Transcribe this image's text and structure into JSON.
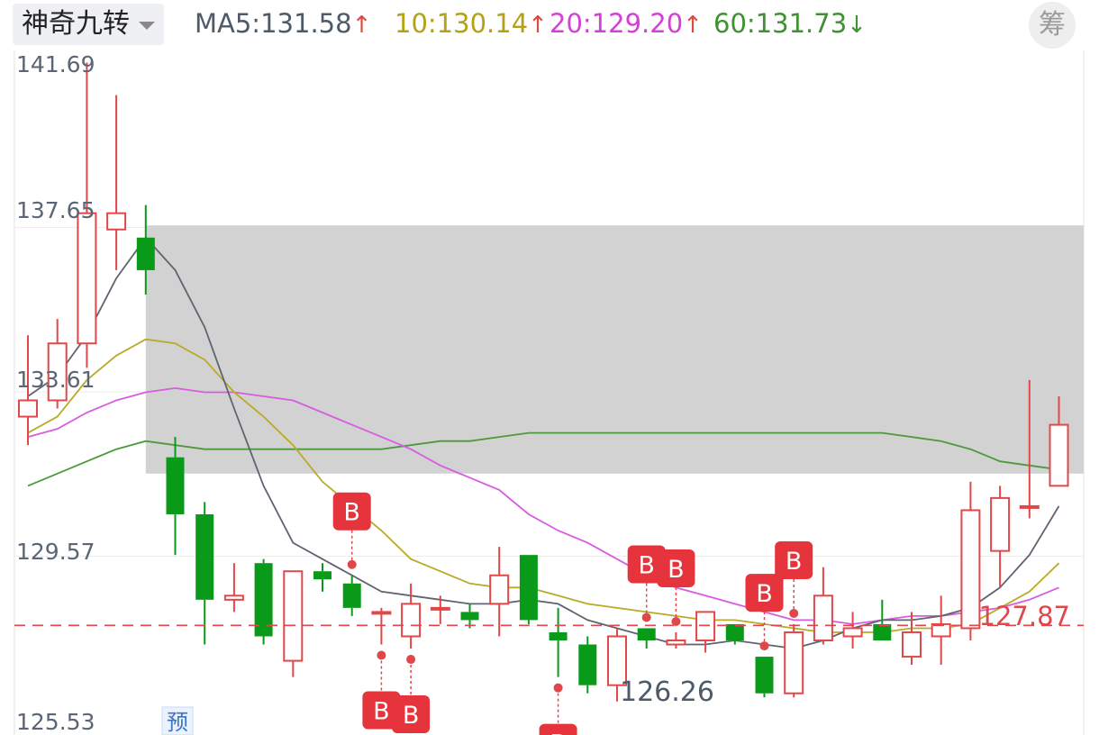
{
  "header": {
    "indicator_name": "神奇九转",
    "ma": [
      {
        "label": "MA5:",
        "value": "131.58",
        "arrow": "↑",
        "color": "#4d5a6a",
        "arrow_color": "#e2473f"
      },
      {
        "label": "10:",
        "value": "130.14",
        "arrow": "↑",
        "color": "#b3a116",
        "arrow_color": "#e2473f"
      },
      {
        "label": "20:",
        "value": "129.20",
        "arrow": "↑",
        "color": "#d43fd6",
        "arrow_color": "#e2473f"
      },
      {
        "label": "60:",
        "value": "131.73",
        "arrow": "↓",
        "color": "#3f9133",
        "arrow_color": "#3f9133"
      }
    ],
    "chip_button": "筹"
  },
  "chart_data": {
    "type": "candlestick",
    "y_ticks": [
      "141.69",
      "137.65",
      "133.61",
      "129.57",
      "125.53"
    ],
    "ylim": [
      125.53,
      141.69
    ],
    "current_price_label": "127.87",
    "low_label": "126.26",
    "forecast_label": "预",
    "signal_label": "B",
    "colors": {
      "up": "#e2474a",
      "down": "#0a9a1a",
      "ma5": "#5e6470",
      "ma10": "#b8ab25",
      "ma20": "#d95be0",
      "ma60": "#4c9a3c"
    },
    "candles": [
      {
        "o": 133.0,
        "c": 133.4,
        "h": 135.0,
        "l": 132.3
      },
      {
        "o": 133.4,
        "c": 134.8,
        "h": 135.4,
        "l": 133.2
      },
      {
        "o": 134.8,
        "c": 138.0,
        "h": 141.7,
        "l": 134.2
      },
      {
        "o": 137.6,
        "c": 138.0,
        "h": 140.9,
        "l": 136.6
      },
      {
        "o": 137.4,
        "c": 136.6,
        "h": 138.2,
        "l": 136.0
      },
      {
        "o": 132.0,
        "c": 130.6,
        "h": 132.5,
        "l": 129.6
      },
      {
        "o": 130.6,
        "c": 128.5,
        "h": 130.9,
        "l": 127.4
      },
      {
        "o": 128.5,
        "c": 128.6,
        "h": 129.4,
        "l": 128.2
      },
      {
        "o": 129.4,
        "c": 127.6,
        "h": 129.5,
        "l": 127.4
      },
      {
        "o": 127.0,
        "c": 129.2,
        "h": 129.2,
        "l": 126.6
      },
      {
        "o": 129.2,
        "c": 129.0,
        "h": 129.4,
        "l": 128.7
      },
      {
        "o": 128.9,
        "c": 128.3,
        "h": 129.1,
        "l": 128.1
      },
      {
        "o": 128.2,
        "c": 128.2,
        "h": 128.3,
        "l": 127.4
      },
      {
        "o": 127.6,
        "c": 128.4,
        "h": 128.9,
        "l": 127.3
      },
      {
        "o": 128.3,
        "c": 128.3,
        "h": 128.6,
        "l": 127.9
      },
      {
        "o": 128.2,
        "c": 128.0,
        "h": 128.4,
        "l": 127.8
      },
      {
        "o": 128.4,
        "c": 129.1,
        "h": 129.8,
        "l": 127.6
      },
      {
        "o": 129.6,
        "c": 128.0,
        "h": 129.6,
        "l": 127.9
      },
      {
        "o": 127.7,
        "c": 127.5,
        "h": 128.3,
        "l": 126.6
      },
      {
        "o": 127.4,
        "c": 126.4,
        "h": 127.6,
        "l": 126.2
      },
      {
        "o": 126.4,
        "c": 127.6,
        "h": 127.8,
        "l": 126.0
      },
      {
        "o": 127.8,
        "c": 127.5,
        "h": 127.8,
        "l": 127.3
      },
      {
        "o": 127.4,
        "c": 127.5,
        "h": 127.7,
        "l": 127.3
      },
      {
        "o": 127.5,
        "c": 128.2,
        "h": 128.2,
        "l": 127.2
      },
      {
        "o": 127.9,
        "c": 127.5,
        "h": 127.9,
        "l": 127.4
      },
      {
        "o": 127.1,
        "c": 126.2,
        "h": 127.1,
        "l": 126.1
      },
      {
        "o": 126.2,
        "c": 127.7,
        "h": 127.9,
        "l": 126.1
      },
      {
        "o": 127.5,
        "c": 128.6,
        "h": 129.3,
        "l": 127.4
      },
      {
        "o": 127.6,
        "c": 127.8,
        "h": 128.2,
        "l": 127.3
      },
      {
        "o": 127.9,
        "c": 127.5,
        "h": 128.5,
        "l": 127.5
      },
      {
        "o": 127.1,
        "c": 127.7,
        "h": 128.2,
        "l": 126.9
      },
      {
        "o": 127.6,
        "c": 127.9,
        "h": 128.6,
        "l": 126.9
      },
      {
        "o": 127.8,
        "c": 130.7,
        "h": 131.4,
        "l": 127.5
      },
      {
        "o": 129.7,
        "c": 131.0,
        "h": 131.3,
        "l": 128.8
      },
      {
        "o": 130.8,
        "c": 130.8,
        "h": 133.9,
        "l": 130.5
      },
      {
        "o": 131.3,
        "c": 132.8,
        "h": 133.5,
        "l": 131.3
      }
    ],
    "ma5": [
      133.5,
      134.0,
      135.0,
      136.4,
      137.4,
      136.6,
      135.2,
      133.2,
      131.3,
      129.9,
      129.5,
      129.1,
      128.7,
      128.6,
      128.5,
      128.4,
      128.4,
      128.5,
      128.4,
      128.0,
      127.8,
      127.6,
      127.4,
      127.4,
      127.5,
      127.4,
      127.3,
      127.5,
      127.8,
      128.0,
      128.0,
      128.1,
      128.3,
      128.8,
      129.6,
      130.8
    ],
    "ma10": [
      132.6,
      133.0,
      133.9,
      134.5,
      134.9,
      134.8,
      134.4,
      133.6,
      133.0,
      132.3,
      131.4,
      130.8,
      130.2,
      129.5,
      129.2,
      128.9,
      128.8,
      128.8,
      128.6,
      128.4,
      128.3,
      128.2,
      128.1,
      128.0,
      128.0,
      127.9,
      127.8,
      127.7,
      127.7,
      127.7,
      127.8,
      127.8,
      127.9,
      128.3,
      128.7,
      129.4
    ],
    "ma20": [
      132.5,
      132.7,
      133.1,
      133.4,
      133.6,
      133.7,
      133.6,
      133.6,
      133.5,
      133.4,
      133.1,
      132.8,
      132.5,
      132.2,
      131.8,
      131.5,
      131.2,
      130.6,
      130.2,
      129.9,
      129.5,
      129.1,
      128.8,
      128.6,
      128.4,
      128.2,
      128.0,
      128.0,
      127.9,
      128.0,
      128.1,
      128.1,
      128.2,
      128.3,
      128.5,
      128.8
    ],
    "ma60": [
      131.3,
      131.6,
      131.9,
      132.2,
      132.4,
      132.3,
      132.2,
      132.2,
      132.2,
      132.2,
      132.2,
      132.2,
      132.2,
      132.3,
      132.4,
      132.4,
      132.5,
      132.6,
      132.6,
      132.6,
      132.6,
      132.6,
      132.6,
      132.6,
      132.6,
      132.6,
      132.6,
      132.6,
      132.6,
      132.6,
      132.5,
      132.4,
      132.2,
      131.9,
      131.8,
      131.7
    ],
    "b_signals": [
      {
        "index": 11,
        "position": "above"
      },
      {
        "index": 12,
        "position": "below"
      },
      {
        "index": 13,
        "position": "below"
      },
      {
        "index": 18,
        "position": "below"
      },
      {
        "index": 21,
        "position": "above"
      },
      {
        "index": 22,
        "position": "above"
      },
      {
        "index": 25,
        "position": "above"
      },
      {
        "index": 26,
        "position": "above"
      }
    ],
    "zone_price_range": [
      131.6,
      137.7
    ],
    "zone_start_index": 4
  }
}
